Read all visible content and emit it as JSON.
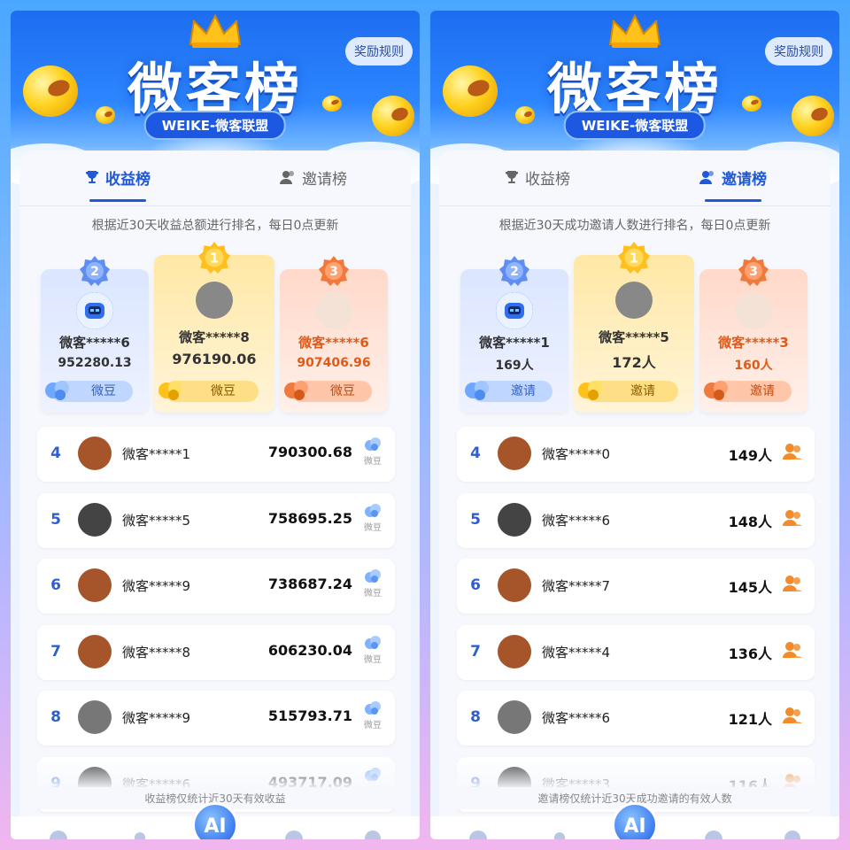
{
  "colors": {
    "accent": "#1f59d8",
    "gold": "#ffd21f",
    "orange": "#e05a17"
  },
  "panels": [
    {
      "hero": {
        "title": "微客榜",
        "subtitle": "WEIKE-微客联盟",
        "rules": "奖励规则"
      },
      "tabs": [
        {
          "label": "收益榜",
          "active": true
        },
        {
          "label": "邀请榜",
          "active": false
        }
      ],
      "description": "根据近30天收益总额进行排名，每日0点更新",
      "podium": {
        "second": {
          "medal": "2",
          "name": "微客*****6",
          "value": "952280.13",
          "chip": "微豆"
        },
        "first": {
          "medal": "1",
          "name": "微客*****8",
          "value": "976190.06",
          "chip": "微豆"
        },
        "third": {
          "medal": "3",
          "name": "微客*****6",
          "value": "907406.96",
          "chip": "微豆"
        }
      },
      "rows": [
        {
          "rank": "4",
          "name": "微客*****1",
          "value": "790300.68",
          "unit": "微豆"
        },
        {
          "rank": "5",
          "name": "微客*****5",
          "value": "758695.25",
          "unit": "微豆"
        },
        {
          "rank": "6",
          "name": "微客*****9",
          "value": "738687.24",
          "unit": "微豆"
        },
        {
          "rank": "7",
          "name": "微客*****8",
          "value": "606230.04",
          "unit": "微豆"
        },
        {
          "rank": "8",
          "name": "微客*****9",
          "value": "515793.71",
          "unit": "微豆"
        },
        {
          "rank": "9",
          "name": "微客*****6",
          "value": "493717.09",
          "unit": "微豆"
        }
      ],
      "footer": "收益榜仅统计近30天有效收益",
      "ai": "AI"
    },
    {
      "hero": {
        "title": "微客榜",
        "subtitle": "WEIKE-微客联盟",
        "rules": "奖励规则"
      },
      "tabs": [
        {
          "label": "收益榜",
          "active": false
        },
        {
          "label": "邀请榜",
          "active": true
        }
      ],
      "description": "根据近30天成功邀请人数进行排名，每日0点更新",
      "podium": {
        "second": {
          "medal": "2",
          "name": "微客*****1",
          "value": "169人",
          "chip": "邀请"
        },
        "first": {
          "medal": "1",
          "name": "微客*****5",
          "value": "172人",
          "chip": "邀请"
        },
        "third": {
          "medal": "3",
          "name": "微客*****3",
          "value": "160人",
          "chip": "邀请"
        }
      },
      "rows": [
        {
          "rank": "4",
          "name": "微客*****0",
          "value": "149人",
          "unit": ""
        },
        {
          "rank": "5",
          "name": "微客*****6",
          "value": "148人",
          "unit": ""
        },
        {
          "rank": "6",
          "name": "微客*****7",
          "value": "145人",
          "unit": ""
        },
        {
          "rank": "7",
          "name": "微客*****4",
          "value": "136人",
          "unit": ""
        },
        {
          "rank": "8",
          "name": "微客*****6",
          "value": "121人",
          "unit": ""
        },
        {
          "rank": "9",
          "name": "微客*****3",
          "value": "116人",
          "unit": ""
        }
      ],
      "footer": "邀请榜仅统计近30天成功邀请的有效人数",
      "ai": "AI"
    }
  ]
}
